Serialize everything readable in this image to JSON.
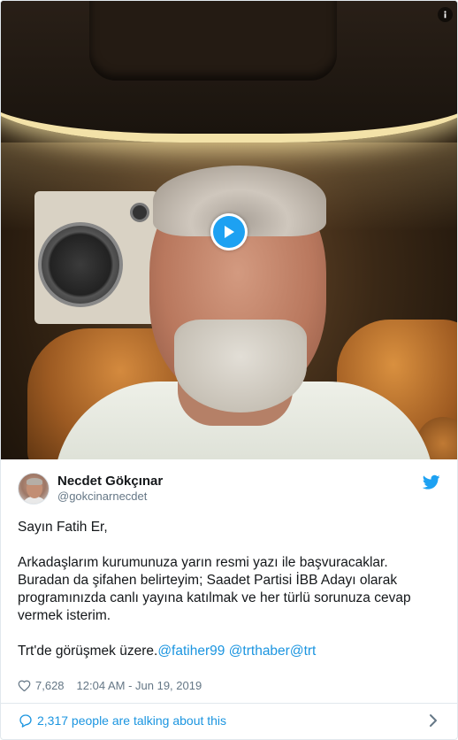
{
  "author": {
    "name": "Necdet Gökçınar",
    "handle": "@gokcinarnecdet"
  },
  "tweet": {
    "line_greeting": "Sayın Fatih Er,",
    "paragraph_1": "Arkadaşlarım kurumunuza yarın resmi yazı ile başvuracaklar. Buradan da şifahen belirteyim; Saadet Partisi İBB Adayı olarak programınızda canlı yayına katılmak ve her türlü sorunuza cevap vermek isterim.",
    "closing_text": "Trt'de görüşmek üzere.",
    "mention_1": "@fatiher99",
    "mention_2": "@trthaber",
    "mention_3": "@trt"
  },
  "meta": {
    "like_count": "7,628",
    "timestamp": "12:04 AM - Jun 19, 2019"
  },
  "footer": {
    "conversation_label": "2,317 people are talking about this"
  },
  "icons": {
    "play": "play-icon",
    "info": "info-icon",
    "bird": "twitter-bird-icon",
    "heart": "heart-icon",
    "bubble": "speech-bubble-icon",
    "chevron": "chevron-right-icon"
  },
  "colors": {
    "accent": "#1da1f2",
    "link": "#1b95e0",
    "muted": "#657786"
  }
}
